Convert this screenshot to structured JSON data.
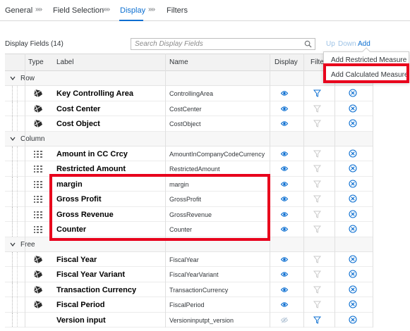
{
  "wizard": {
    "steps": [
      "General",
      "Field Selection",
      "Display",
      "Filters"
    ],
    "separator": "»»"
  },
  "toolbar": {
    "title": "Display Fields (14)",
    "search_placeholder": "Search Display Fields",
    "up_label": "Up",
    "down_label": "Down",
    "add_label": "Add"
  },
  "menu": {
    "items": [
      "Add Restricted Measure",
      "Add Calculated Measure"
    ]
  },
  "table": {
    "columns": [
      "Type",
      "Label",
      "Name",
      "Display",
      "Filte"
    ],
    "groups": [
      {
        "title": "Row",
        "rows": [
          {
            "label": "Key Controlling Area",
            "name": "ControllingArea",
            "type_icon": "dimension-icon",
            "display": "visible",
            "filter": "active"
          },
          {
            "label": "Cost Center",
            "name": "CostCenter",
            "type_icon": "dimension-icon",
            "display": "visible",
            "filter": "inactive"
          },
          {
            "label": "Cost Object",
            "name": "CostObject",
            "type_icon": "dimension-icon",
            "display": "visible",
            "filter": "inactive"
          }
        ]
      },
      {
        "title": "Column",
        "rows": [
          {
            "label": "Amount in CC Crcy",
            "name": "AmountInCompanyCodeCurrency",
            "type_icon": "measure-icon",
            "display": "visible",
            "filter": "inactive"
          },
          {
            "label": "Restricted Amount",
            "name": "RestrictedAmount",
            "type_icon": "measure-icon",
            "display": "visible",
            "filter": "inactive"
          },
          {
            "label": "margin",
            "name": "margin",
            "type_icon": "measure-icon",
            "display": "visible",
            "filter": "inactive"
          },
          {
            "label": "Gross Profit",
            "name": "GrossProfit",
            "type_icon": "measure-icon",
            "display": "visible",
            "filter": "inactive"
          },
          {
            "label": "Gross Revenue",
            "name": "GrossRevenue",
            "type_icon": "measure-icon",
            "display": "visible",
            "filter": "inactive"
          },
          {
            "label": "Counter",
            "name": "Counter",
            "type_icon": "measure-icon",
            "display": "visible",
            "filter": "inactive"
          }
        ]
      },
      {
        "title": "Free",
        "rows": [
          {
            "label": "Fiscal Year",
            "name": "FiscalYear",
            "type_icon": "dimension-icon",
            "display": "visible",
            "filter": "inactive"
          },
          {
            "label": "Fiscal Year Variant",
            "name": "FiscalYearVariant",
            "type_icon": "dimension-icon",
            "display": "visible",
            "filter": "inactive"
          },
          {
            "label": "Transaction Currency",
            "name": "TransactionCurrency",
            "type_icon": "dimension-icon",
            "display": "visible",
            "filter": "inactive"
          },
          {
            "label": "Fiscal Period",
            "name": "FiscalPeriod",
            "type_icon": "dimension-icon",
            "display": "visible",
            "filter": "inactive"
          },
          {
            "label": "Version input",
            "name": "Versioninputpt_version",
            "type_icon": "none",
            "display": "hidden",
            "filter": "active"
          }
        ]
      }
    ]
  },
  "colors": {
    "accent": "#0a6ed1",
    "highlight": "#e8001c",
    "filter_active": "#0a6ed1",
    "filter_inactive": "#c9c9c9"
  }
}
